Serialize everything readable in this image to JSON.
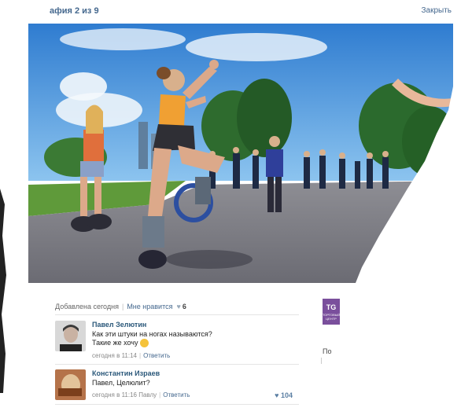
{
  "header": {
    "counter": "афия 2 из 9",
    "close_label": "Закрыть"
  },
  "photo": {
    "description_icon": "photo-of-people-jumping-in-kangoo-jump-boots"
  },
  "meta": {
    "added": "Добавлена сегодня",
    "like_label": "Мне нравится",
    "likes": "6"
  },
  "comments": [
    {
      "author": "Павел Зелютин",
      "text_line1": "Как эти штуки на ногах называются?",
      "text_line2": "Такие же хочу",
      "time": "сегодня в 11:14",
      "reply": "Ответить"
    },
    {
      "author": "Константин Израев",
      "text_line1": "Павел, Целюлит?",
      "time": "сегодня в 11:16 Павлу",
      "reply": "Ответить",
      "likes": "104"
    }
  ],
  "side": {
    "logo_text": "TG",
    "logo_sub": "ТОРГОВЫЙ ЦЕНТР",
    "po": "По"
  },
  "colors": {
    "link": "#45688e",
    "author": "#2b587a",
    "sky": "#3f8fd6"
  }
}
